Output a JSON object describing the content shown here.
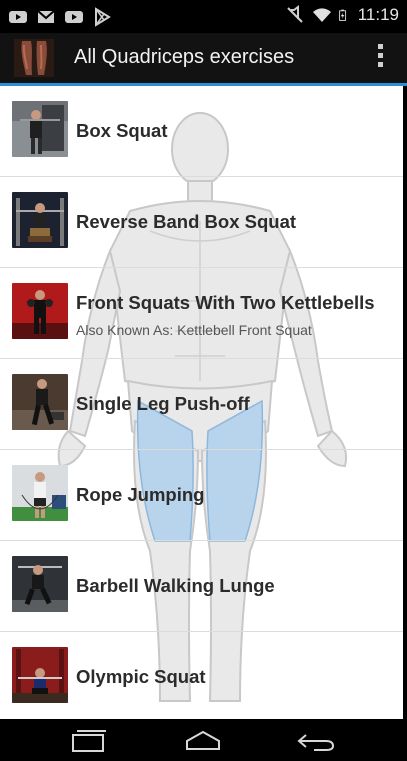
{
  "status_bar": {
    "time": "11:19",
    "left_icons": [
      "youtube-icon",
      "gmail-icon",
      "youtube-icon",
      "play-store-icon"
    ],
    "right_icons": [
      "mute-icon",
      "wifi-icon",
      "battery-icon"
    ]
  },
  "action_bar": {
    "title": "All Quadriceps exercises",
    "accent_color": "#2d8fd2"
  },
  "exercises": [
    {
      "title": "Box Squat",
      "subtitle": ""
    },
    {
      "title": "Reverse Band Box Squat",
      "subtitle": ""
    },
    {
      "title": "Front Squats With Two Kettlebells",
      "subtitle": "Also Known As: Kettlebell Front Squat"
    },
    {
      "title": "Single Leg Push-off",
      "subtitle": ""
    },
    {
      "title": "Rope Jumping",
      "subtitle": ""
    },
    {
      "title": "Barbell Walking Lunge",
      "subtitle": ""
    },
    {
      "title": "Olympic Squat",
      "subtitle": ""
    }
  ],
  "nav_bar": {
    "icons": [
      "recent-apps-icon",
      "home-icon",
      "back-icon"
    ]
  }
}
